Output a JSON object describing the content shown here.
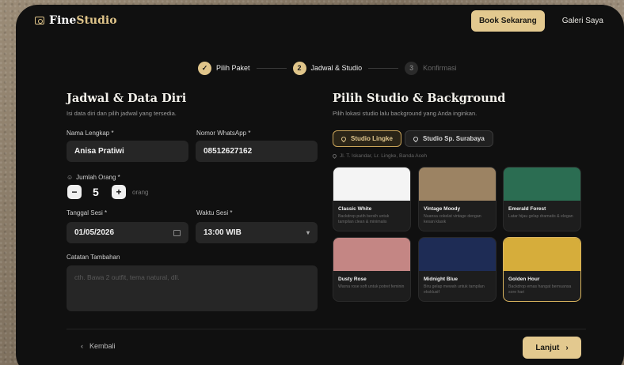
{
  "brand": {
    "name_a": "Fine",
    "name_b": "Studio",
    "accent": "#e0c58a"
  },
  "nav": {
    "book": "Book Sekarang",
    "gallery": "Galeri Saya"
  },
  "steps": [
    {
      "num": "✓",
      "label": "Pilih Paket",
      "state": "done"
    },
    {
      "num": "2",
      "label": "Jadwal & Studio",
      "state": "active"
    },
    {
      "num": "3",
      "label": "Konfirmasi",
      "state": "todo"
    }
  ],
  "left": {
    "title": "Jadwal & Data Diri",
    "subtitle": "Isi data diri dan pilih jadwal yang tersedia.",
    "name_label": "Nama Lengkap *",
    "name_value": "Anisa Pratiwi",
    "wa_label": "Nomor WhatsApp *",
    "wa_value": "08512627162",
    "people_label": "Jumlah Orang *",
    "people_count": "5",
    "people_unit": "orang",
    "date_label": "Tanggal Sesi *",
    "date_value": "01/05/2026",
    "time_label": "Waktu Sesi *",
    "time_value": "13:00 WIB",
    "notes_label": "Catatan Tambahan",
    "notes_placeholder": "cth. Bawa 2 outfit, tema natural, dll."
  },
  "right": {
    "title": "Pilih Studio & Background",
    "subtitle": "Pilih lokasi studio lalu background yang Anda inginkan.",
    "studio_a": "Studio Lingke",
    "studio_b": "Studio Sp. Surabaya",
    "address": "Jl. T. Iskandar, Lr. Lingke, Banda Aceh",
    "backgrounds": [
      {
        "name": "Classic White",
        "desc": "Backdrop putih bersih untuk tampilan clean & minimalis",
        "color": "#f4f4f4"
      },
      {
        "name": "Vintage Moody",
        "desc": "Nuansa cokelat vintage dengan kesan klasik",
        "color": "#9c8363"
      },
      {
        "name": "Emerald Forest",
        "desc": "Latar hijau gelap dramatis & elegan",
        "color": "#2b6d52"
      },
      {
        "name": "Dusty Rose",
        "desc": "Warna rose soft untuk potret feminin",
        "color": "#c48684"
      },
      {
        "name": "Midnight Blue",
        "desc": "Biru gelap mewah untuk tampilan eksklusif",
        "color": "#1e2c55"
      },
      {
        "name": "Golden Hour",
        "desc": "Backdrop emas hangat bernuansa sore hari",
        "color": "#d6ad3b"
      }
    ]
  },
  "footer": {
    "back": "Kembali",
    "next": "Lanjut"
  }
}
